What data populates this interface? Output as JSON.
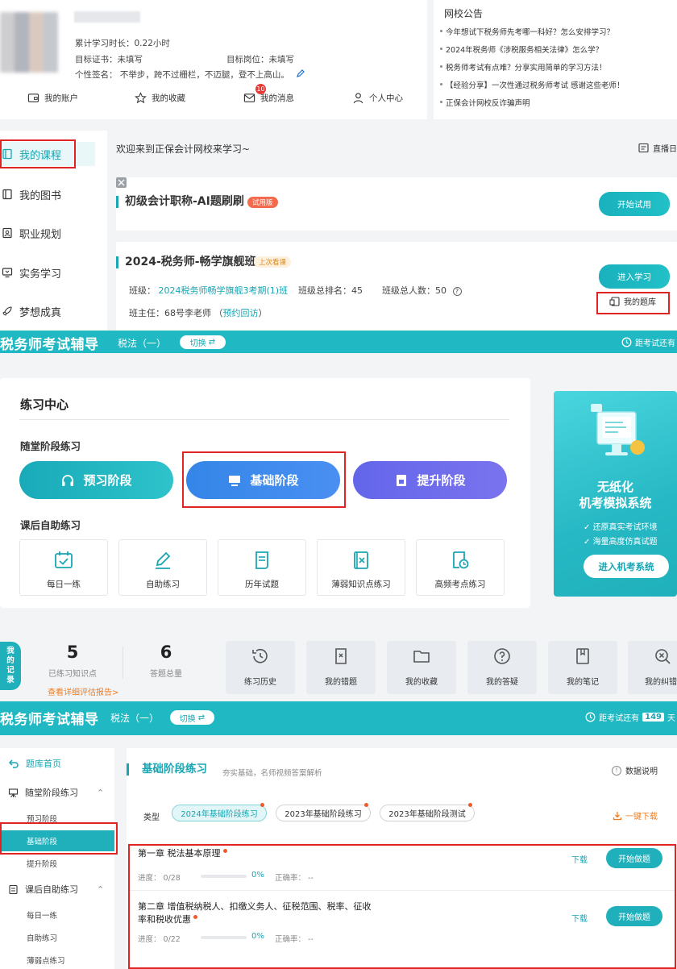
{
  "profile": {
    "study_time": "累计学习时长：0.22小时",
    "target_cert": "目标证书：未填写",
    "target_post": "目标岗位：未填写",
    "signature": "个性签名：  不举步，跨不过栅栏，不迈腿，登不上高山。",
    "tabs": [
      "我的账户",
      "我的收藏",
      "我的消息",
      "个人中心"
    ],
    "message_badge": "10"
  },
  "notice": {
    "title": "网校公告",
    "items": [
      "今年想试下税务师先考哪一科好？怎么安排学习？",
      "2024年税务师《涉税服务相关法律》怎么学？",
      "税务师考试有点难？分享实用简单的学习方法！",
      "【经验分享】一次性通过税务师考试 感谢这些老师！",
      "正保会计网校反诈骗声明"
    ]
  },
  "sidebar1": {
    "items": [
      "我的课程",
      "我的图书",
      "职业规划",
      "实务学习",
      "梦想成真"
    ]
  },
  "courses": {
    "welcome": "欢迎来到正保会计网校来学习~",
    "live": "直播日",
    "card1": {
      "title": "初级会计职称-AI题刷刷",
      "tag": "试用版",
      "button": "开始试用"
    },
    "card2": {
      "title": "2024-税务师-畅学旗舰班",
      "tag": "上次看课",
      "class_label": "班级：",
      "class_name": "2024税务师畅学旗舰3考期(1)班",
      "rank_label": "班级总排名：",
      "rank": "45",
      "total_label": "班级总人数：",
      "total": "50",
      "teacher_label": "班主任：",
      "teacher": "68号李老师",
      "appointment": "预约回访",
      "paren_open": "（",
      "paren_close": "）",
      "enter_button": "进入学习",
      "question_bank": "我的题库"
    }
  },
  "banner": {
    "title": "税务师考试辅导",
    "subject": "税法（一）",
    "switch": "切换",
    "countdown_prefix": "距考试还有",
    "countdown_days": "149",
    "countdown_unit": "天"
  },
  "practice": {
    "title": "练习中心",
    "section1": "随堂阶段练习",
    "stages": [
      "预习阶段",
      "基础阶段",
      "提升阶段"
    ],
    "section2": "课后自助练习",
    "tiles": [
      "每日一练",
      "自助练习",
      "历年试题",
      "薄弱知识点练习",
      "高频考点练习"
    ]
  },
  "promo": {
    "line1": "无纸化",
    "line2": "机考模拟系统",
    "bullets": [
      "还原真实考试环境",
      "海量高度仿真试题"
    ],
    "button": "进入机考系统"
  },
  "records": {
    "tag": "我的记录",
    "stats": [
      {
        "value": "5",
        "label": "已练习知识点"
      },
      {
        "value": "6",
        "label": "答题总量"
      }
    ],
    "report_link": "查看详细评估报告>",
    "tiles": [
      "练习历史",
      "我的错题",
      "我的收藏",
      "我的答疑",
      "我的笔记",
      "我的纠错"
    ]
  },
  "sidebar3": {
    "home": "题库首页",
    "group1": "随堂阶段练习",
    "group1_items": [
      "预习阶段",
      "基础阶段",
      "提升阶段"
    ],
    "group2": "课后自助练习",
    "group2_items": [
      "每日一练",
      "自助练习",
      "薄弱点练习"
    ]
  },
  "basic": {
    "title": "基础阶段练习",
    "subtitle": "夯实基础，名师视频答案解析",
    "help": "数据说明",
    "type_label": "类型",
    "chips": [
      "2024年基础阶段练习",
      "2023年基础阶段练习",
      "2023年基础阶段测试"
    ],
    "download_all": "一键下载",
    "chapters": [
      {
        "title": "第一章 税法基本原理",
        "progress": "进度：  0/28",
        "fill": 0,
        "pct": "0%",
        "accuracy": "正确率： --",
        "download": "下载",
        "button": "开始做题"
      },
      {
        "title_line1": "第二章 增值税纳税人、扣缴义务人、征税范围、税率、征收",
        "title_line2": "率和税收优惠",
        "progress": "进度：  0/22",
        "fill": 0,
        "pct": "0%",
        "accuracy": "正确率： --",
        "download": "下载",
        "button": "开始做题"
      }
    ]
  },
  "colors": {
    "accent": "#1fb0bb",
    "highlight_red": "#e02424",
    "orange": "#f07c1f"
  }
}
